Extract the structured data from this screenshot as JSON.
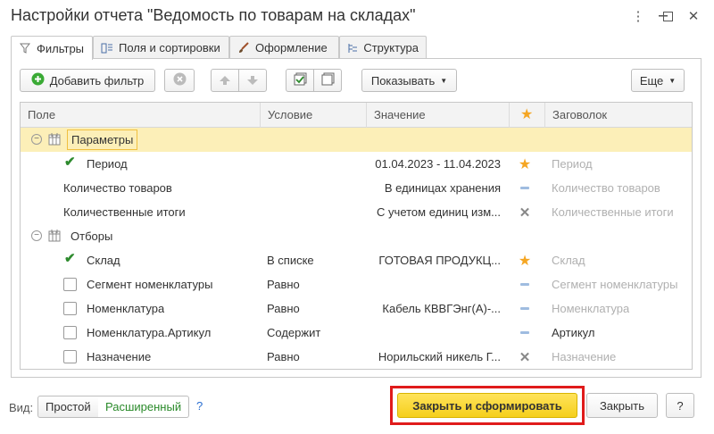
{
  "window": {
    "title": "Настройки отчета \"Ведомость по товарам на складах\"",
    "menu_icon": "vertical-dots-icon",
    "minimize_icon": "minimize-icon",
    "maximize_icon": "maximize-icon",
    "close_icon": "close-icon"
  },
  "tabs": [
    {
      "label": "Фильтры",
      "icon": "filter-icon"
    },
    {
      "label": "Поля и сортировки",
      "icon": "fields-icon"
    },
    {
      "label": "Оформление",
      "icon": "brush-icon"
    },
    {
      "label": "Структура",
      "icon": "structure-icon"
    }
  ],
  "toolbar": {
    "add_filter": "Добавить фильтр",
    "show": "Показывать",
    "more": "Еще"
  },
  "grid": {
    "headers": {
      "field": "Поле",
      "condition": "Условие",
      "value": "Значение",
      "title": "Заговолок"
    },
    "groups": {
      "params": "Параметры",
      "filters": "Отборы"
    },
    "rows": [
      {
        "field": "Период",
        "condition": "",
        "value": "01.04.2023 - 11.04.2023",
        "use": "star",
        "title": "Период",
        "checkbox": true,
        "checked": true
      },
      {
        "field": "Количество товаров",
        "condition": "",
        "value": "В единицах хранения",
        "use": "dash",
        "title": "Количество товаров",
        "checkbox": false,
        "checked": false
      },
      {
        "field": "Количественные итоги",
        "condition": "",
        "value": "С учетом единиц изм...",
        "use": "cross",
        "title": "Количественные итоги",
        "checkbox": false,
        "checked": false
      },
      {
        "field": "Склад",
        "condition": "В списке",
        "value": "ГОТОВАЯ ПРОДУКЦ...",
        "use": "star",
        "title": "Склад",
        "checkbox": true,
        "checked": true
      },
      {
        "field": "Сегмент номенклатуры",
        "condition": "Равно",
        "value": "",
        "use": "dash",
        "title": "Сегмент номенклатуры",
        "checkbox": true,
        "checked": false
      },
      {
        "field": "Номенклатура",
        "condition": "Равно",
        "value": "Кабель КВВГЭнг(А)-...",
        "use": "dash",
        "title": "Номенклатура",
        "checkbox": true,
        "checked": false
      },
      {
        "field": "Номенклатура.Артикул",
        "condition": "Содержит",
        "value": "",
        "use": "dash",
        "title": "Артикул",
        "checkbox": true,
        "checked": false
      },
      {
        "field": "Назначение",
        "condition": "Равно",
        "value": "Норильский никель Г...",
        "use": "cross",
        "title": "Назначение",
        "checkbox": true,
        "checked": false
      }
    ]
  },
  "bottom": {
    "view_label": "Вид:",
    "simple": "Простой",
    "extended": "Расширенный",
    "help": "?",
    "close_and_build": "Закрыть и сформировать",
    "close": "Закрыть",
    "help_button": "?"
  },
  "colors": {
    "selected_row": "#fcefb8",
    "primary_button": "#f5cf1c",
    "highlight": "#e01b1b",
    "star": "#f5a623"
  }
}
